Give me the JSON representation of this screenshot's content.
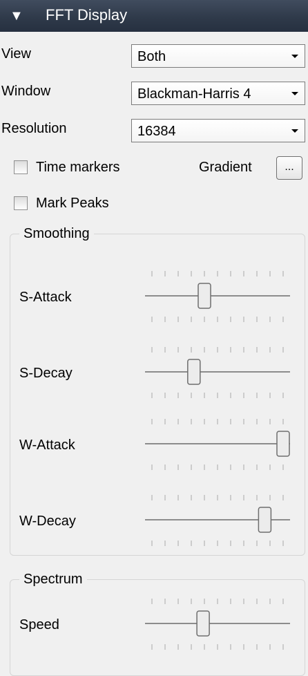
{
  "header": {
    "title": "FFT Display",
    "collapse_icon": "triangle-down-icon"
  },
  "fields": {
    "view": {
      "label": "View",
      "value": "Both"
    },
    "window": {
      "label": "Window",
      "value": "Blackman-Harris 4"
    },
    "resolution": {
      "label": "Resolution",
      "value": "16384"
    }
  },
  "options": {
    "time_markers": {
      "label": "Time markers",
      "checked": false
    },
    "mark_peaks": {
      "label": "Mark Peaks",
      "checked": false
    },
    "gradient_label": "Gradient",
    "gradient_button": "..."
  },
  "smoothing": {
    "title": "Smoothing",
    "sliders": [
      {
        "label": "S-Attack",
        "level": 0.4
      },
      {
        "label": "S-Decay",
        "level": 0.32
      },
      {
        "label": "W-Attack",
        "level": 1.0
      },
      {
        "label": "W-Decay",
        "level": 0.86
      }
    ]
  },
  "spectrum": {
    "title": "Spectrum",
    "sliders": [
      {
        "label": "Speed",
        "level": 0.39
      }
    ]
  }
}
